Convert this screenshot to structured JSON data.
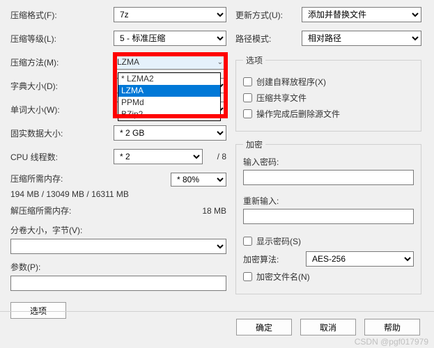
{
  "left": {
    "format": {
      "label": "压缩格式(F):",
      "value": "7z"
    },
    "level": {
      "label": "压缩等级(L):",
      "value": "5 - 标准压缩"
    },
    "method": {
      "label": "压缩方法(M):",
      "value": "LZMA"
    },
    "dict": {
      "label": "字典大小(D):",
      "value": ""
    },
    "word": {
      "label": "单词大小(W):",
      "value": ""
    },
    "solid": {
      "label": "固实数据大小:",
      "value": "* 2 GB"
    },
    "cpu": {
      "label": "CPU 线程数:",
      "value": "* 2",
      "total": "/ 8"
    },
    "mem_compress_label": "压缩所需内存:",
    "mem_compress_value": "* 80%",
    "mem_compress_detail": "194 MB / 13049 MB / 16311 MB",
    "mem_decompress_label": "解压缩所需内存:",
    "mem_decompress_value": "18 MB",
    "split_label": "分卷大小，字节(V):",
    "params_label": "参数(P):",
    "options_btn": "选项"
  },
  "right": {
    "update": {
      "label": "更新方式(U):",
      "value": "添加并替换文件"
    },
    "pathmode": {
      "label": "路径模式:",
      "value": "相对路径"
    },
    "opts_legend": "选项",
    "opt1": "创建自释放程序(X)",
    "opt2": "压缩共享文件",
    "opt3": "操作完成后删除源文件",
    "enc_legend": "加密",
    "pwd_label": "输入密码:",
    "repwd_label": "重新输入:",
    "showpwd": "显示密码(S)",
    "enc_method_label": "加密算法:",
    "enc_method_value": "AES-256",
    "enc_filename": "加密文件名(N)"
  },
  "dropdown": {
    "items": [
      "* LZMA2",
      "LZMA",
      "PPMd",
      "BZip2"
    ],
    "selected_index": 1
  },
  "buttons": {
    "ok": "确定",
    "cancel": "取消",
    "help": "帮助"
  },
  "watermark": "CSDN @pgf017979"
}
